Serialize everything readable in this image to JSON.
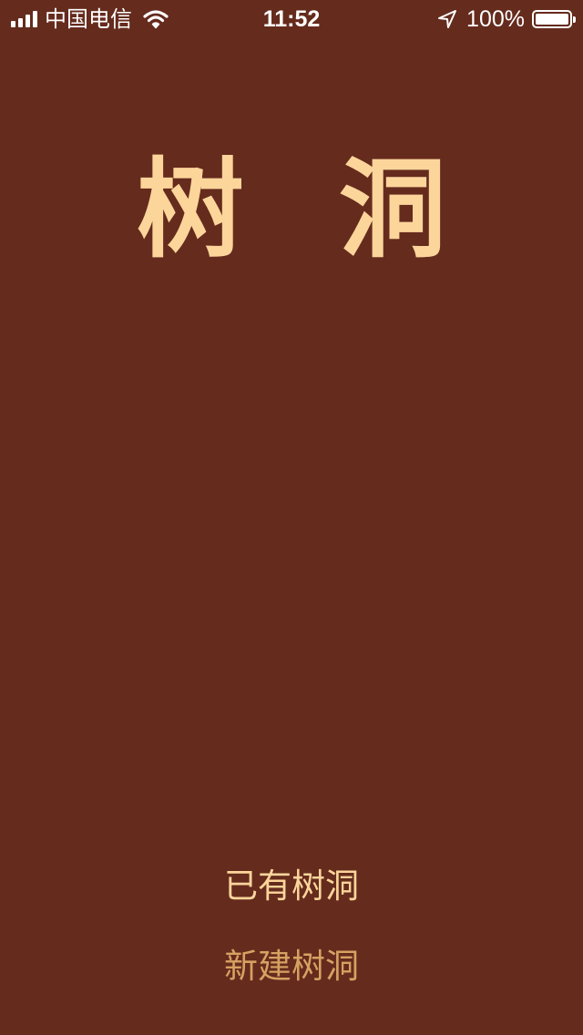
{
  "status_bar": {
    "carrier": "中国电信",
    "time": "11:52",
    "battery_percent": "100%",
    "battery_level": 1.0,
    "signal_bars": 4,
    "icons": [
      "signal-icon",
      "wifi-icon",
      "location-arrow-icon",
      "battery-icon"
    ]
  },
  "title": {
    "char1": "树",
    "char2": "洞"
  },
  "actions": {
    "existing_label": "已有树洞",
    "new_label": "新建树洞"
  },
  "colors": {
    "background": "#652b1d",
    "title": "#fcd59b",
    "primary_text": "#fcd59b",
    "secondary_text": "#d7a162",
    "status_text": "#ffffff"
  }
}
